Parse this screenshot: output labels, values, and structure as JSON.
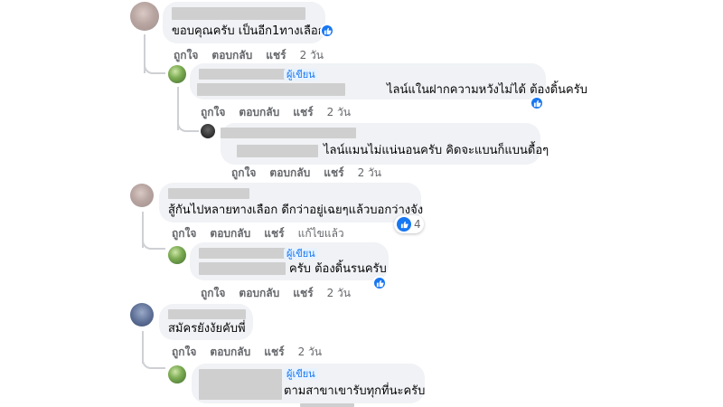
{
  "comments": [
    {
      "text": "ขอบคุณครับ เป็นอีก1ทางเลือก",
      "actions": {
        "like": "ถูกใจ",
        "reply": "ตอบกลับ",
        "share": "แชร์",
        "time": "2 วัน"
      },
      "replies": [
        {
          "badge": "ผู้เขียน",
          "text": "ไลน์แในฝากความหวังไม่ได้ ต้องดิ้นครับ",
          "actions": {
            "like": "ถูกใจ",
            "reply": "ตอบกลับ",
            "share": "แชร์",
            "time": "2 วัน"
          }
        },
        {
          "text": "ไลน์แมนไม่แน่นอนครับ คิดจะแบนก็แบนดื้อๆ",
          "actions": {
            "like": "ถูกใจ",
            "reply": "ตอบกลับ",
            "share": "แชร์",
            "time": "2 วัน"
          }
        }
      ]
    },
    {
      "text": "สู้กันไปหลายทางเลือก ดีกว่าอยู่เฉยๆแล้วบอกว่างจัง",
      "reaction_count": "4",
      "actions": {
        "like": "ถูกใจ",
        "reply": "ตอบกลับ",
        "share": "แชร์",
        "edited": "แก้ไขแล้ว"
      },
      "replies": [
        {
          "badge": "ผู้เขียน",
          "text": "ครับ ต้องดิ้นรนครับ",
          "actions": {
            "like": "ถูกใจ",
            "reply": "ตอบกลับ",
            "share": "แชร์",
            "time": "2 วัน"
          }
        }
      ]
    },
    {
      "text": "สมัครยังงัยคับพี่",
      "actions": {
        "like": "ถูกใจ",
        "reply": "ตอบกลับ",
        "share": "แชร์",
        "time": "2 วัน"
      },
      "replies": [
        {
          "badge": "ผู้เขียน",
          "text": "ตามสาขาเขารับทุกที่นะครับ"
        }
      ]
    }
  ],
  "colors": {
    "bubble": "#f0f2f5",
    "author_badge": "#1877f2",
    "muted": "#65676b",
    "like_blue": "#1877f2"
  },
  "icons": {
    "like": "thumbs-up-icon"
  }
}
